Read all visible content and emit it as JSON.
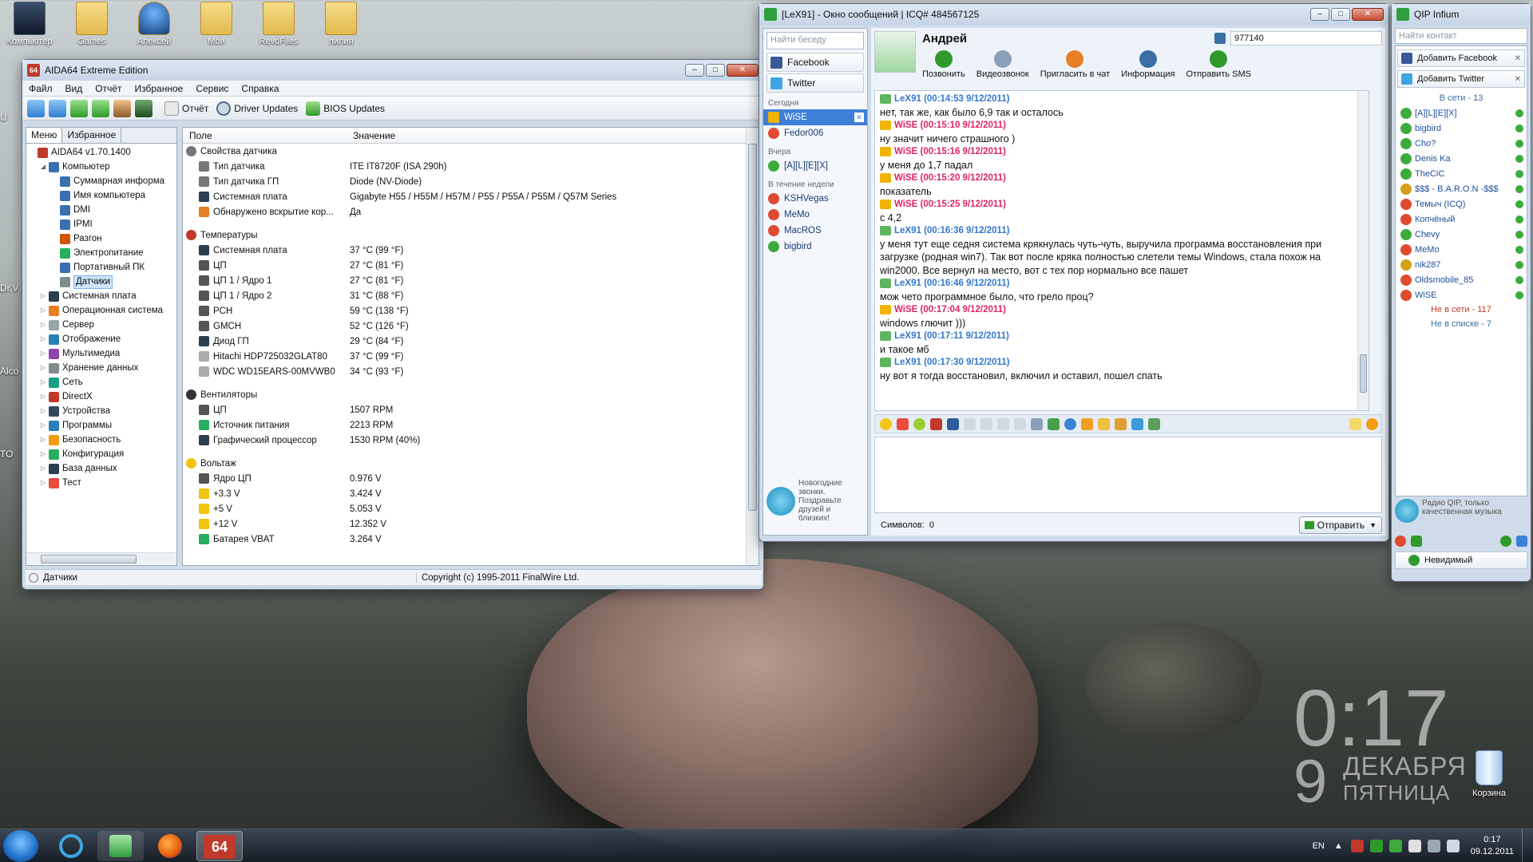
{
  "desktop": {
    "icons": [
      {
        "label": "Компьютер"
      },
      {
        "label": "Games"
      },
      {
        "label": "Алексей"
      },
      {
        "label": "Мои"
      },
      {
        "label": "RevdFiles"
      },
      {
        "label": "лилия"
      }
    ],
    "left_edge_labels": [
      "U",
      "Dr.V",
      "Alco",
      "TO"
    ],
    "clock": {
      "time": "0:17",
      "day": "9",
      "month": "ДЕКАБРЯ",
      "weekday": "ПЯТНИЦА"
    },
    "recycle": "Корзина"
  },
  "aida": {
    "title": "AIDA64 Extreme Edition",
    "app_icon_text": "64",
    "menu": [
      "Файл",
      "Вид",
      "Отчёт",
      "Избранное",
      "Сервис",
      "Справка"
    ],
    "toolbar": {
      "report": "Отчёт",
      "driver": "Driver Updates",
      "bios": "BIOS Updates"
    },
    "tabs": [
      "Меню",
      "Избранное"
    ],
    "tree": [
      {
        "label": "AIDA64 v1.70.1400",
        "lvl": 0,
        "ex": "",
        "c": "#c0392b"
      },
      {
        "label": "Компьютер",
        "lvl": 1,
        "ex": "◢",
        "c": "#3a6fb0"
      },
      {
        "label": "Суммарная информа",
        "lvl": 2,
        "ex": "",
        "c": "#3a6fb0"
      },
      {
        "label": "Имя компьютера",
        "lvl": 2,
        "ex": "",
        "c": "#3a6fb0"
      },
      {
        "label": "DMI",
        "lvl": 2,
        "ex": "",
        "c": "#3a6fb0"
      },
      {
        "label": "IPMI",
        "lvl": 2,
        "ex": "",
        "c": "#3a6fb0"
      },
      {
        "label": "Разгон",
        "lvl": 2,
        "ex": "",
        "c": "#d35400"
      },
      {
        "label": "Электропитание",
        "lvl": 2,
        "ex": "",
        "c": "#27ae60"
      },
      {
        "label": "Портативный ПК",
        "lvl": 2,
        "ex": "",
        "c": "#3a6fb0"
      },
      {
        "label": "Датчики",
        "lvl": 2,
        "ex": "",
        "c": "#7f8c8d",
        "sel": true
      },
      {
        "label": "Системная плата",
        "lvl": 1,
        "ex": "▷",
        "c": "#2c3e50"
      },
      {
        "label": "Операционная система",
        "lvl": 1,
        "ex": "▷",
        "c": "#e67e22"
      },
      {
        "label": "Сервер",
        "lvl": 1,
        "ex": "▷",
        "c": "#95a5a6"
      },
      {
        "label": "Отображение",
        "lvl": 1,
        "ex": "▷",
        "c": "#2980b9"
      },
      {
        "label": "Мультимедиа",
        "lvl": 1,
        "ex": "▷",
        "c": "#8e44ad"
      },
      {
        "label": "Хранение данных",
        "lvl": 1,
        "ex": "▷",
        "c": "#7f8c8d"
      },
      {
        "label": "Сеть",
        "lvl": 1,
        "ex": "▷",
        "c": "#16a085"
      },
      {
        "label": "DirectX",
        "lvl": 1,
        "ex": "▷",
        "c": "#c0392b"
      },
      {
        "label": "Устройства",
        "lvl": 1,
        "ex": "▷",
        "c": "#34495e"
      },
      {
        "label": "Программы",
        "lvl": 1,
        "ex": "▷",
        "c": "#2980b9"
      },
      {
        "label": "Безопасность",
        "lvl": 1,
        "ex": "▷",
        "c": "#f39c12"
      },
      {
        "label": "Конфигурация",
        "lvl": 1,
        "ex": "▷",
        "c": "#27ae60"
      },
      {
        "label": "База данных",
        "lvl": 1,
        "ex": "▷",
        "c": "#2c3e50"
      },
      {
        "label": "Тест",
        "lvl": 1,
        "ex": "▷",
        "c": "#e74c3c"
      }
    ],
    "columns": {
      "field": "Поле",
      "value": "Значение"
    },
    "groups": [
      {
        "title": "Свойства датчика",
        "c": "#777",
        "rows": [
          {
            "f": "Тип датчика",
            "v": "ITE IT8720F  (ISA 290h)",
            "c": "#777"
          },
          {
            "f": "Тип датчика ГП",
            "v": "Diode  (NV-Diode)",
            "c": "#777"
          },
          {
            "f": "Системная плата",
            "v": "Gigabyte H55 / H55M / H57M / P55 / P55A / P55M / Q57M Series",
            "c": "#2c3e50"
          },
          {
            "f": "Обнаружено вскрытие кор...",
            "v": "Да",
            "c": "#e67e22"
          }
        ]
      },
      {
        "title": "Температуры",
        "c": "#c0392b",
        "rows": [
          {
            "f": "Системная плата",
            "v": "37 °C  (99 °F)",
            "c": "#2c3e50"
          },
          {
            "f": "ЦП",
            "v": "27 °C  (81 °F)",
            "c": "#555"
          },
          {
            "f": "ЦП 1 / Ядро 1",
            "v": "27 °C  (81 °F)",
            "c": "#555"
          },
          {
            "f": "ЦП 1 / Ядро 2",
            "v": "31 °C  (88 °F)",
            "c": "#555"
          },
          {
            "f": "PCH",
            "v": "59 °C  (138 °F)",
            "c": "#555"
          },
          {
            "f": "GMCH",
            "v": "52 °C  (126 °F)",
            "c": "#555"
          },
          {
            "f": "Диод ГП",
            "v": "29 °C  (84 °F)",
            "c": "#2c3e50"
          },
          {
            "f": "Hitachi HDP725032GLAT80",
            "v": "37 °C  (99 °F)",
            "c": "#aaa"
          },
          {
            "f": "WDC WD15EARS-00MVWB0",
            "v": "34 °C  (93 °F)",
            "c": "#aaa"
          }
        ]
      },
      {
        "title": "Вентиляторы",
        "c": "#333",
        "rows": [
          {
            "f": "ЦП",
            "v": "1507 RPM",
            "c": "#555"
          },
          {
            "f": "Источник питания",
            "v": "2213 RPM",
            "c": "#27ae60"
          },
          {
            "f": "Графический процессор",
            "v": "1530 RPM  (40%)",
            "c": "#2c3e50"
          }
        ]
      },
      {
        "title": "Вольтаж",
        "c": "#f1c40f",
        "rows": [
          {
            "f": "Ядро ЦП",
            "v": "0.976 V",
            "c": "#555"
          },
          {
            "f": "+3.3 V",
            "v": "3.424 V",
            "c": "#f1c40f"
          },
          {
            "f": "+5 V",
            "v": "5.053 V",
            "c": "#f1c40f"
          },
          {
            "f": "+12 V",
            "v": "12.352 V",
            "c": "#f1c40f"
          },
          {
            "f": "Батарея VBAT",
            "v": "3.264 V",
            "c": "#27ae60"
          }
        ]
      }
    ],
    "status": {
      "left": "Датчики",
      "right": "Copyright (c) 1995-2011 FinalWire Ltd."
    }
  },
  "chat": {
    "title": "[LeX91] - Окно сообщений | ICQ# 484567125",
    "search_placeholder": "Найти беседу",
    "services": [
      "Facebook",
      "Twitter"
    ],
    "sections": {
      "today": "Сегодня",
      "yesterday": "Вчера",
      "week": "В течение недели"
    },
    "today": [
      {
        "name": "WiSE",
        "sel": true
      }
    ],
    "today2": [
      {
        "name": "Fedor006"
      }
    ],
    "yesterday_items": [
      {
        "name": "[A][L][E][X]"
      }
    ],
    "week_items": [
      {
        "name": "KSHVegas"
      },
      {
        "name": "MeMo"
      },
      {
        "name": "MacROS"
      },
      {
        "name": "bigbird"
      }
    ],
    "promo": "Новогодние звонки. Поздравьте друзей и близких!",
    "contact_name": "Андрей",
    "contact_uin": "977140",
    "actions": [
      "Позвонить",
      "Видеозвонок",
      "Пригласить в чат",
      "Информация",
      "Отправить SMS"
    ],
    "messages": [
      {
        "who": "me",
        "h": "LeX91 (00:14:53 9/12/2011)",
        "t": "нет, так же, как было 6,9 так и осталось"
      },
      {
        "who": "them",
        "h": "WiSE (00:15:10 9/12/2011)",
        "t": "ну значит ничего страшного )"
      },
      {
        "who": "them",
        "h": "WiSE (00:15:16 9/12/2011)",
        "t": "у меня до 1,7 падал"
      },
      {
        "who": "them",
        "h": "WiSE (00:15:20 9/12/2011)",
        "t": "показатель"
      },
      {
        "who": "them",
        "h": "WiSE (00:15:25 9/12/2011)",
        "t": "с 4,2"
      },
      {
        "who": "me",
        "h": "LeX91 (00:16:36 9/12/2011)",
        "t": "у меня тут еще седня система крякнулась чуть-чуть, выручила программа восстановления при загрузке (родная win7). Так вот после кряка полностью слетели темы Windows, стала похож на win2000. Все вернул на место, вот с тех пор нормально все пашет"
      },
      {
        "who": "me",
        "h": "LeX91 (00:16:46 9/12/2011)",
        "t": "мож чето программное было, что грело проц?"
      },
      {
        "who": "them",
        "h": "WiSE (00:17:04 9/12/2011)",
        "t": "windows глючит )))"
      },
      {
        "who": "me",
        "h": "LeX91 (00:17:11 9/12/2011)",
        "t": "и такое мб"
      },
      {
        "who": "me",
        "h": "LeX91 (00:17:30 9/12/2011)",
        "t": "ну вот я тогда восстановил, включил и оставил, пошел спать"
      }
    ],
    "symbols_label": "Символов:",
    "symbols_count": "0",
    "send": "Отправить"
  },
  "clist": {
    "title": "QIP Infium",
    "search_placeholder": "Найти контакт",
    "add_fb": "Добавить Facebook",
    "add_tw": "Добавить Twitter",
    "online_group": "В сети - 13",
    "contacts": [
      {
        "n": "[A][L][E][X]",
        "c": "#3cab3c"
      },
      {
        "n": "bigbird",
        "c": "#3cab3c"
      },
      {
        "n": "Cho?",
        "c": "#3cab3c"
      },
      {
        "n": "Denis Ka",
        "c": "#3cab3c"
      },
      {
        "n": "TheCiC",
        "c": "#3cab3c"
      },
      {
        "n": "$$$ - B.A.R.O.N -$$$",
        "c": "#d4a017"
      },
      {
        "n": "Темыч (ICQ)",
        "c": "#e04a2f"
      },
      {
        "n": "Копчёный",
        "c": "#e04a2f"
      },
      {
        "n": "Chevy",
        "c": "#3cab3c"
      },
      {
        "n": "MeMo",
        "c": "#e04a2f"
      },
      {
        "n": "nik287",
        "c": "#d4a017"
      },
      {
        "n": "Oldsmobile_85",
        "c": "#e04a2f"
      },
      {
        "n": "WiSE",
        "c": "#e04a2f"
      }
    ],
    "offline_group": "Не в сети - 117",
    "notlist_group": "Не в списке - 7",
    "radio": "Радио QIP, только качественная музыка",
    "status": "Невидимый"
  },
  "taskbar": {
    "lang": "EN",
    "time": "0:17",
    "date": "09.12.2011",
    "aida_label": "64"
  }
}
